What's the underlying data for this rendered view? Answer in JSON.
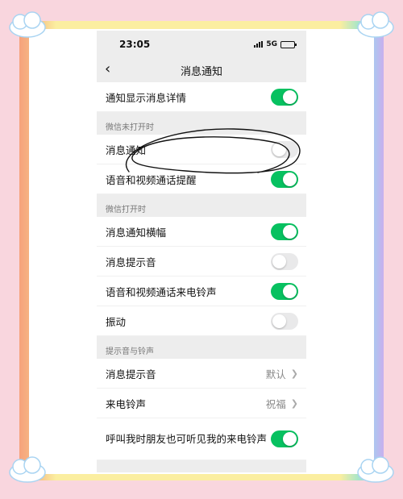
{
  "status_bar": {
    "time": "23:05",
    "network": "5G",
    "battery_level": 0.6
  },
  "nav": {
    "title": "消息通知",
    "back_icon": "chevron-left-icon"
  },
  "rows_top": [
    {
      "label": "通知显示消息详情",
      "toggle": true
    }
  ],
  "section1": {
    "title": "微信未打开时",
    "rows": [
      {
        "label": "消息通知",
        "toggle": false
      },
      {
        "label": "语音和视频通话提醒",
        "toggle": true
      }
    ]
  },
  "section2": {
    "title": "微信打开时",
    "rows": [
      {
        "label": "消息通知横幅",
        "toggle": true
      },
      {
        "label": "消息提示音",
        "toggle": false
      },
      {
        "label": "语音和视频通话来电铃声",
        "toggle": true
      },
      {
        "label": "振动",
        "toggle": false
      }
    ]
  },
  "section3": {
    "title": "提示音与铃声",
    "rows": [
      {
        "label": "消息提示音",
        "value": "默认"
      },
      {
        "label": "来电铃声",
        "value": "祝福"
      },
      {
        "label": "呼叫我时朋友也可听见我的来电铃声",
        "toggle": true
      }
    ]
  },
  "colors": {
    "toggle_on": "#07c160",
    "toggle_off": "#e9e9ea",
    "background": "#f9d6de"
  }
}
